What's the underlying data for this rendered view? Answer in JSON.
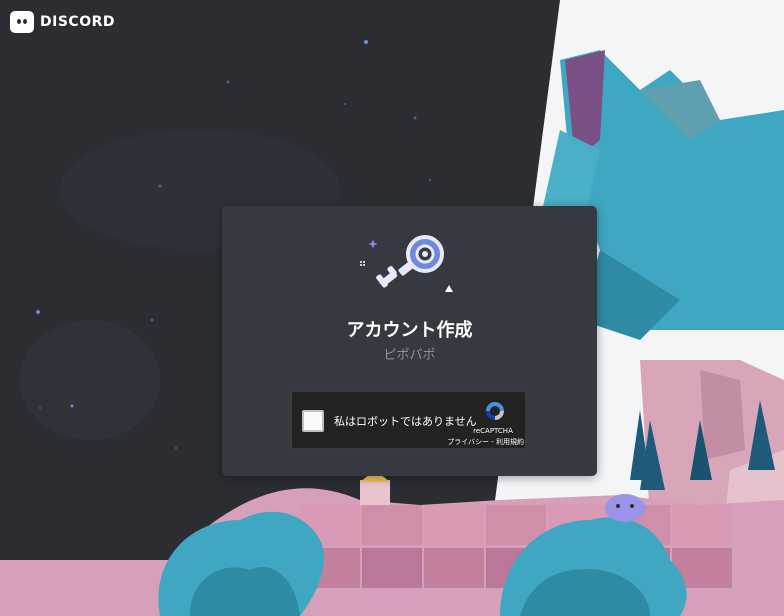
{
  "brand": {
    "name": "DISCORD"
  },
  "modal": {
    "title": "アカウント作成",
    "subtitle": "ピポパポ"
  },
  "recaptcha": {
    "label": "私はロボットではありません",
    "brand": "reCAPTCHA",
    "privacy": "プライバシー",
    "separator": " - ",
    "terms": "利用規約",
    "checked": false
  },
  "icons": {
    "logo": "discord-logo-icon",
    "key": "key-illustration",
    "recaptcha": "recaptcha-logo-icon"
  },
  "colors": {
    "background": "#2b2d33",
    "modal": "#36393f",
    "accent": "#7289da",
    "captcha_bg": "#222222"
  }
}
